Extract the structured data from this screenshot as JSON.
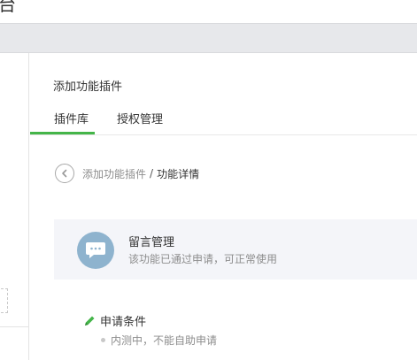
{
  "header": {
    "title_partial": "台"
  },
  "page": {
    "title": "添加功能插件",
    "tabs": [
      {
        "label": "插件库",
        "active": true
      },
      {
        "label": "授权管理",
        "active": false
      }
    ],
    "breadcrumb": {
      "parent": "添加功能插件",
      "separator": "/",
      "current": "功能详情"
    }
  },
  "plugin": {
    "name": "留言管理",
    "status": "该功能已通过申请，可正常使用",
    "icon": "chat-bubble-icon"
  },
  "conditions": {
    "title": "申请条件",
    "items": [
      "内测中，不能自助申请"
    ]
  },
  "colors": {
    "accent": "#44b549",
    "panel_bg": "#f4f5f9",
    "avatar_bg": "#8eb3ce",
    "band_bg": "#e7e8eb",
    "muted_text": "#8d8d8d"
  }
}
